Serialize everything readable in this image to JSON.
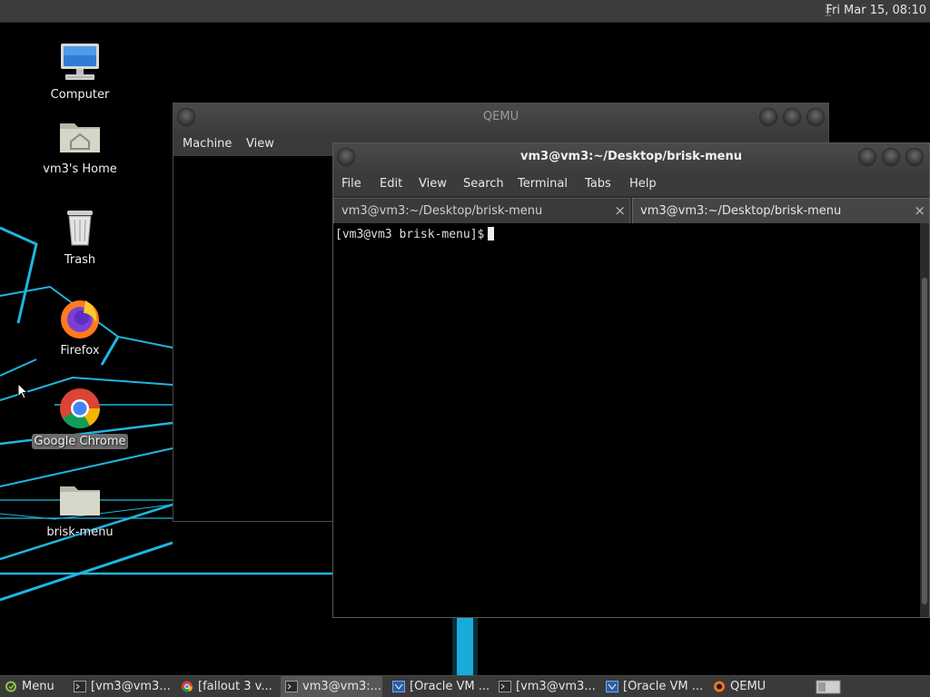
{
  "top_panel": {
    "clock": "Fri Mar 15, 08:10"
  },
  "desktop": {
    "icons": [
      {
        "label": "Computer",
        "icon": "computer-icon"
      },
      {
        "label": "vm3's Home",
        "icon": "home-folder-icon"
      },
      {
        "label": "Trash",
        "icon": "trash-icon"
      },
      {
        "label": "Firefox",
        "icon": "firefox-icon"
      },
      {
        "label": "Google Chrome",
        "icon": "chrome-icon",
        "selected": true
      },
      {
        "label": "brisk-menu",
        "icon": "folder-icon"
      }
    ]
  },
  "qemu_window": {
    "title": "QEMU",
    "menu": [
      "Machine",
      "View"
    ]
  },
  "terminal_window": {
    "title": "vm3@vm3:~/Desktop/brisk-menu",
    "menu": [
      "File",
      "Edit",
      "View",
      "Search",
      "Terminal",
      "Tabs",
      "Help"
    ],
    "tabs": [
      {
        "label": "vm3@vm3:~/Desktop/brisk-menu",
        "close": "×"
      },
      {
        "label": "vm3@vm3:~/Desktop/brisk-menu",
        "close": "×",
        "active": true
      }
    ],
    "prompt": "[vm3@vm3 brisk-menu]$"
  },
  "taskbar": {
    "menu_label": "Menu",
    "tasks": [
      {
        "label": "[vm3@vm3...",
        "icon": "terminal-icon"
      },
      {
        "label": "[fallout 3 v...",
        "icon": "chrome-icon"
      },
      {
        "label": "vm3@vm3:...",
        "icon": "terminal-icon",
        "active": true
      },
      {
        "label": "[Oracle VM ...",
        "icon": "virtualbox-icon"
      },
      {
        "label": "[vm3@vm3...",
        "icon": "terminal-icon"
      },
      {
        "label": "[Oracle VM ...",
        "icon": "virtualbox-icon"
      },
      {
        "label": "QEMU",
        "icon": "qemu-icon"
      }
    ]
  },
  "colors": {
    "wallpaper_line": "#1fb6e0",
    "panel": "#3c3c3c",
    "terminal_bg": "#000000"
  }
}
